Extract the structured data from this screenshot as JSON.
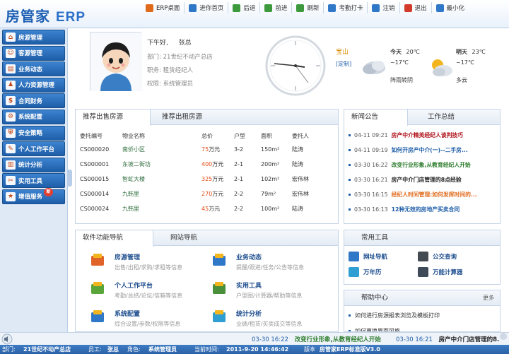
{
  "app": {
    "logo_text": "房管家",
    "logo_suffix": "ERP"
  },
  "toolbar": [
    {
      "label": "ERP桌面",
      "icon": "home-icon",
      "color": "#e06a1b"
    },
    {
      "label": "进你首页",
      "icon": "house-icon",
      "color": "#2f78c8"
    },
    {
      "label": "后退",
      "icon": "back-arrow-icon",
      "color": "#3c9a3c"
    },
    {
      "label": "前进",
      "icon": "forward-arrow-icon",
      "color": "#3c9a3c"
    },
    {
      "label": "刷新",
      "icon": "refresh-icon",
      "color": "#3c9a3c"
    },
    {
      "label": "考勤打卡",
      "icon": "clock-in-icon",
      "color": "#2f78c8"
    },
    {
      "label": "注销",
      "icon": "logout-icon",
      "color": "#2f78c8"
    },
    {
      "label": "退出",
      "icon": "exit-icon",
      "color": "#d23a2a"
    },
    {
      "label": "最小化",
      "icon": "minimize-icon",
      "color": "#2f78c8"
    }
  ],
  "sidebar": {
    "items": [
      {
        "label": "房源管理",
        "icon": "house-icon"
      },
      {
        "label": "客源管理",
        "icon": "customer-icon"
      },
      {
        "label": "业务动态",
        "icon": "business-icon"
      },
      {
        "label": "人力资源管理",
        "icon": "people-icon"
      },
      {
        "label": "合同财务",
        "icon": "contract-icon"
      },
      {
        "label": "系统配置",
        "icon": "settings-icon"
      },
      {
        "label": "安全策略",
        "icon": "security-icon"
      },
      {
        "label": "个人工作平台",
        "icon": "personal-icon"
      },
      {
        "label": "统计分析",
        "icon": "chart-icon"
      },
      {
        "label": "实用工具",
        "icon": "tools-icon"
      },
      {
        "label": "增值服务",
        "icon": "gift-icon",
        "badge": "新"
      }
    ]
  },
  "profile": {
    "greeting": "下午好,",
    "user_name": "张总",
    "dept_label": "部门:",
    "dept_value": "21世纪不动产总店",
    "role_label": "职务:",
    "role_value": "租赁经纪人",
    "perm_label": "权限:",
    "perm_value": "系统管理员"
  },
  "weather": {
    "city": "宝山",
    "custom_label": "[定制]",
    "today": {
      "label": "今天",
      "high": "20℃",
      "low": "~17℃",
      "desc": "阵雨转阴"
    },
    "tomorrow": {
      "label": "明天",
      "high": "23℃",
      "low": "~17℃",
      "desc": "多云"
    }
  },
  "listings": {
    "tabs": [
      "推荐出售房源",
      "推荐出租房源"
    ],
    "columns": [
      "委托编号",
      "物业名称",
      "总价",
      "户型",
      "面积",
      "委托人"
    ],
    "rows": [
      {
        "id": "CS000020",
        "name": "南侨小区",
        "price": "75",
        "unit": "万元",
        "type": "3-2",
        "area": "150m²",
        "agent": "陆涛"
      },
      {
        "id": "CS000001",
        "name": "东坡二街坊",
        "price": "400",
        "unit": "万元",
        "type": "2-1",
        "area": "200m²",
        "agent": "陆涛"
      },
      {
        "id": "CS000015",
        "name": "智虹大楼",
        "price": "325",
        "unit": "万元",
        "type": "2-1",
        "area": "102m²",
        "agent": "宏伟林"
      },
      {
        "id": "CS000014",
        "name": "九韩里",
        "price": "270",
        "unit": "万元",
        "type": "2-2",
        "area": "79m²",
        "agent": "宏伟林"
      },
      {
        "id": "CS000024",
        "name": "九韩里",
        "price": "45",
        "unit": "万元",
        "type": "2-2",
        "area": "100m²",
        "agent": "陆涛"
      }
    ]
  },
  "news": {
    "tabs": [
      "新闻公告",
      "工作总结"
    ],
    "items": [
      {
        "date": "04-11 09:21",
        "title": "房产中介精英经纪人谈判技巧",
        "color": "#b0121b"
      },
      {
        "date": "04-11 09:19",
        "title": "如何开房产中介(一)--二手房...",
        "color": "#1f5ea8"
      },
      {
        "date": "03-30 16:22",
        "title": "改变行业形象,从教育经纪人开始",
        "color": "#2e7d2e"
      },
      {
        "date": "03-30 16:21",
        "title": "房产中介门店管理的8点经验",
        "color": "#222222"
      },
      {
        "date": "03-30 16:15",
        "title": "经纪人时间管理:如何发挥时间的...",
        "color": "#e06a1b"
      },
      {
        "date": "03-30 16:13",
        "title": "12种无效的房地产买卖合同",
        "color": "#1f5ea8"
      }
    ]
  },
  "nav": {
    "tabs": [
      "软件功能导航",
      "网站导航"
    ],
    "items": [
      {
        "title": "房源管理",
        "desc": "出售/出租/求购/求租等信息",
        "icon": "house-nav-icon"
      },
      {
        "title": "业务动态",
        "desc": "提醒/跟进/任务/公告等信息",
        "icon": "business-nav-icon"
      },
      {
        "title": "个人工作平台",
        "desc": "考勤/总结/论坛/信箱等信息",
        "icon": "personal-nav-icon"
      },
      {
        "title": "实用工具",
        "desc": "户型图/计算器/帮助等信息",
        "icon": "tools-nav-icon"
      },
      {
        "title": "系统配置",
        "desc": "综合设置/参数/权限等信息",
        "icon": "settings-nav-icon"
      },
      {
        "title": "统计分析",
        "desc": "业绩/租赁/买卖成交等信息",
        "icon": "chart-nav-icon"
      }
    ]
  },
  "tools": {
    "title": "常用工具",
    "items": [
      {
        "label": "网址导航",
        "icon": "web-nav-icon"
      },
      {
        "label": "公交查询",
        "icon": "bus-icon"
      },
      {
        "label": "万年历",
        "icon": "calendar-icon"
      },
      {
        "label": "万能计算器",
        "icon": "calculator-icon"
      }
    ]
  },
  "help": {
    "title": "帮助中心",
    "more": "更多",
    "items": [
      "如何进行房源报表浏览及模板打印",
      "如何更换界面风格"
    ]
  },
  "ticker": [
    {
      "date": "03-30 16:22",
      "title": "改变行业形象,从教育经纪人开始",
      "color": "#2e7d2e"
    },
    {
      "date": "03-30 16:21",
      "title": "房产中介门店管理的8...",
      "color": "#222222"
    }
  ],
  "statusbar": {
    "dept_label": "部门:",
    "dept": "21世纪不动产总店",
    "staff_label": "员工:",
    "staff": "张总",
    "role_label": "角色:",
    "role": "系统管理员",
    "time_label": "当前时间:",
    "time": "2011-9-20 14:46:42",
    "version_label": "版本",
    "version": "房管家ERP标准版V3.0"
  }
}
